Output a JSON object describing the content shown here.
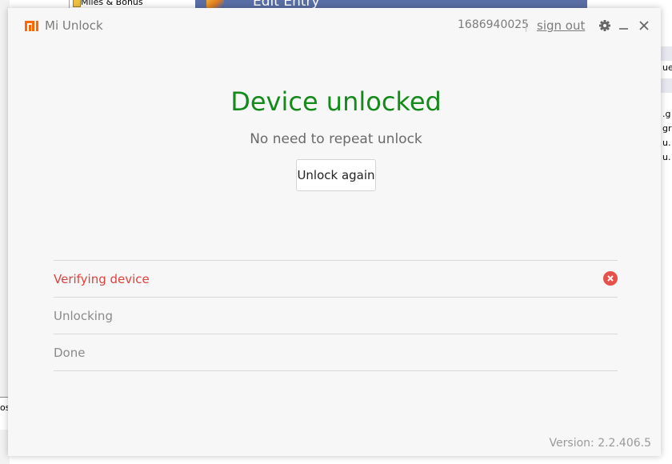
{
  "background": {
    "tree_item": "Miles & Bonus",
    "dialog_title": "Edit Entry",
    "right_fragments": [
      ".g",
      "gr",
      "u.",
      "u."
    ],
    "right_top_fragment": "ue",
    "bottom_left_fragment": "os"
  },
  "titlebar": {
    "app_title": "Mi Unlock",
    "account_id": "1686940025",
    "sign_out_label": "sign out",
    "settings_icon": "gear-icon",
    "minimize_icon": "minimize-icon",
    "close_icon": "close-icon"
  },
  "status": {
    "title": "Device unlocked",
    "subtitle": "No need to repeat unlock",
    "unlock_again_label": "Unlock again"
  },
  "steps": [
    {
      "label": "Verifying device",
      "state": "failed",
      "icon": "error-icon"
    },
    {
      "label": "Unlocking",
      "state": "pending"
    },
    {
      "label": "Done",
      "state": "pending"
    }
  ],
  "footer": {
    "version": "Version: 2.2.406.5"
  },
  "colors": {
    "brand": "#ff6700",
    "success": "#148a1b",
    "error": "#e0403a"
  }
}
